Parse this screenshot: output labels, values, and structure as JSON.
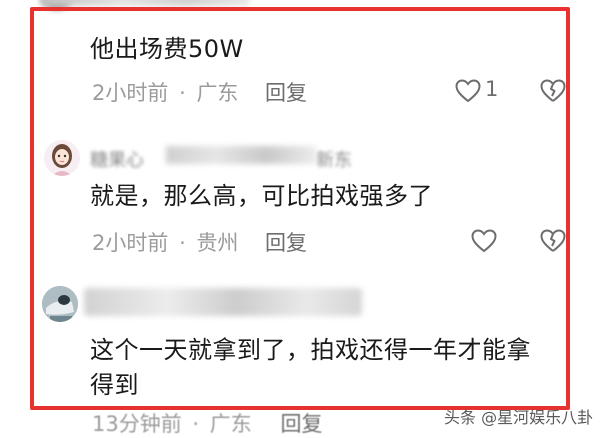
{
  "comments": [
    {
      "text": "他出场费50W",
      "time": "2小时前",
      "separator": "·",
      "location": "广东",
      "reply_label": "回复",
      "like_count": "1"
    },
    {
      "username": "糖果心",
      "username_suffix": "新东",
      "text": "就是，那么高，可比拍戏强多了",
      "time": "2小时前",
      "separator": "·",
      "location": "贵州",
      "reply_label": "回复"
    },
    {
      "text_line1": "这个一天就拿到了，拍戏还得一年才能拿",
      "text_line2": "得到"
    }
  ],
  "bottom_meta": {
    "time": "13分钟前",
    "separator": "·",
    "location": "广东",
    "reply_label": "回复"
  },
  "watermark": "头条 @星河娱乐八卦",
  "colors": {
    "highlight": "#e8322f",
    "meta_text": "#9b9b9b",
    "body_text": "#1a1a1a"
  },
  "icons": [
    "heart-outline-icon",
    "broken-heart-outline-icon"
  ]
}
